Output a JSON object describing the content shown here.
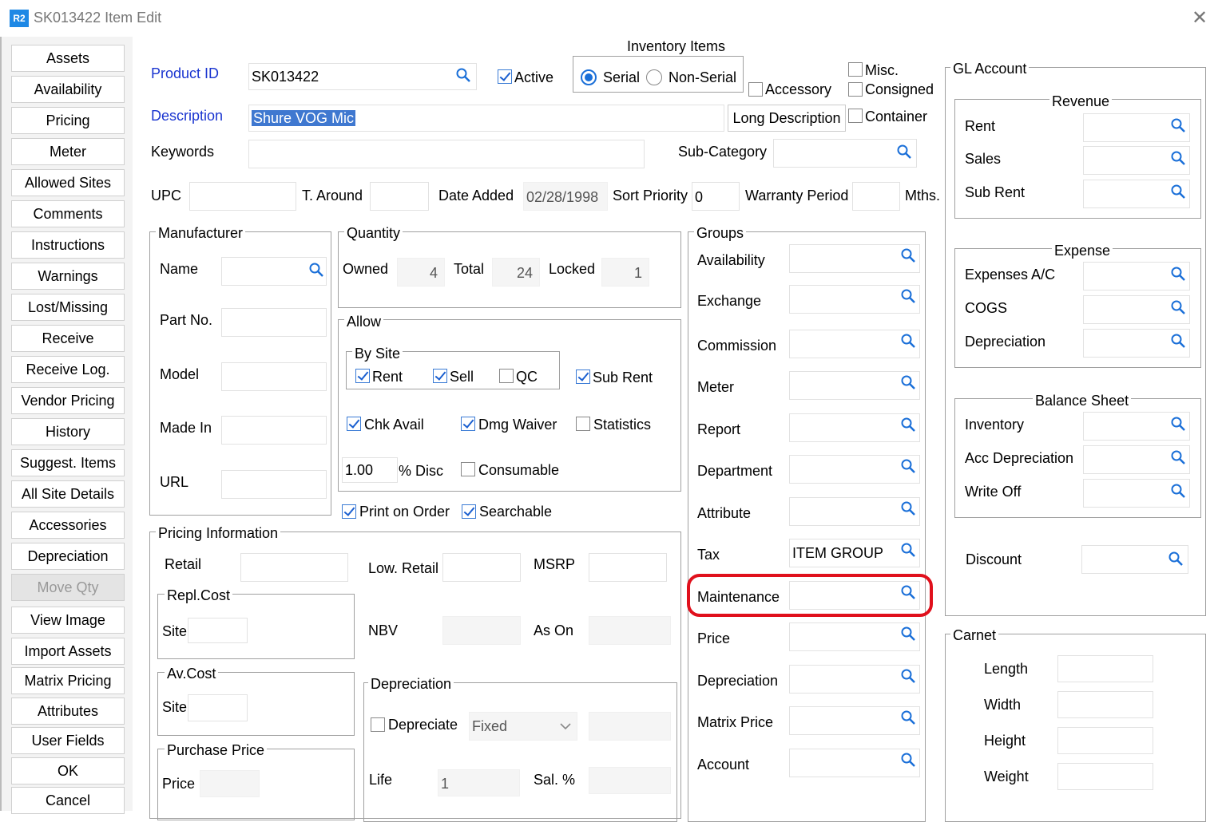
{
  "window": {
    "icon": "R2",
    "title": "SK013422 Item Edit",
    "close": "✕"
  },
  "nav": [
    "Assets",
    "Availability",
    "Pricing",
    "Meter",
    "Allowed Sites",
    "Comments",
    "Instructions",
    "Warnings",
    "Lost/Missing",
    "Receive",
    "Receive Log.",
    "Vendor Pricing",
    "History",
    "Suggest. Items",
    "All Site Details",
    "Accessories",
    "Depreciation",
    "Move Qty",
    "View Image",
    "Import Assets",
    "Matrix Pricing",
    "Attributes",
    "User Fields",
    "OK",
    "Cancel"
  ],
  "header": {
    "product_id_label": "Product ID",
    "product_id": "SK013422",
    "active_label": "Active",
    "active": true,
    "inventory_items_label": "Inventory Items",
    "serial_label": "Serial",
    "nonserial_label": "Non-Serial",
    "accessory_label": "Accessory",
    "misc_label": "Misc.",
    "consigned_label": "Consigned",
    "container_label": "Container",
    "description_label": "Description",
    "description": "Shure VOG Mic",
    "long_description_button": "Long Description",
    "keywords_label": "Keywords",
    "keywords": "",
    "subcategory_label": "Sub-Category",
    "upc_label": "UPC",
    "taround_label": "T. Around",
    "date_added_label": "Date Added",
    "date_added": "02/28/1998",
    "sort_priority_label": "Sort Priority",
    "sort_priority": "0",
    "warranty_label": "Warranty Period",
    "mths_label": "Mths."
  },
  "manufacturer": {
    "title": "Manufacturer",
    "name": "Name",
    "part_no": "Part No.",
    "model": "Model",
    "made_in": "Made In",
    "url": "URL"
  },
  "quantity": {
    "title": "Quantity",
    "owned_label": "Owned",
    "owned": "4",
    "total_label": "Total",
    "total": "24",
    "locked_label": "Locked",
    "locked": "1"
  },
  "allow": {
    "title": "Allow",
    "by_site": "By Site",
    "rent": "Rent",
    "sell": "Sell",
    "qc": "QC",
    "sub_rent": "Sub Rent",
    "chk_avail": "Chk Avail",
    "dmg_waiver": "Dmg Waiver",
    "statistics": "Statistics",
    "disc_value": "1.00",
    "disc_label": "% Disc",
    "consumable": "Consumable"
  },
  "print_on_order": "Print on Order",
  "searchable": "Searchable",
  "pricing": {
    "title": "Pricing Information",
    "retail": "Retail",
    "low_retail": "Low. Retail",
    "msrp": "MSRP",
    "repl_cost": "Repl.Cost",
    "site": "Site",
    "nbv": "NBV",
    "as_on": "As On",
    "av_cost": "Av.Cost",
    "purchase_price": "Purchase Price",
    "price": "Price"
  },
  "depreciation": {
    "title": "Depreciation",
    "depreciate": "Depreciate",
    "method": "Fixed",
    "life_label": "Life",
    "life": "1",
    "sal_label": "Sal. %"
  },
  "groups": {
    "title": "Groups",
    "rows": [
      "Availability",
      "Exchange",
      "Commission",
      "Meter",
      "Report",
      "Department",
      "Attribute",
      "Tax",
      "Maintenance",
      "Price",
      "Depreciation",
      "Matrix Price",
      "Account"
    ],
    "tax_value": "ITEM GROUP"
  },
  "gl": {
    "title": "GL Account",
    "revenue": {
      "title": "Revenue",
      "rows": [
        "Rent",
        "Sales",
        "Sub Rent"
      ]
    },
    "expense": {
      "title": "Expense",
      "rows": [
        "Expenses A/C",
        "COGS",
        "Depreciation"
      ]
    },
    "balance": {
      "title": "Balance Sheet",
      "rows": [
        "Inventory",
        "Acc Depreciation",
        "Write Off"
      ]
    },
    "discount": "Discount"
  },
  "carnet": {
    "title": "Carnet",
    "length": "Length",
    "width": "Width",
    "height": "Height",
    "weight": "Weight"
  },
  "colors": {
    "label_blue": "#1a35d0",
    "highlight": "#e0101c",
    "accent": "#1a6fd8"
  }
}
